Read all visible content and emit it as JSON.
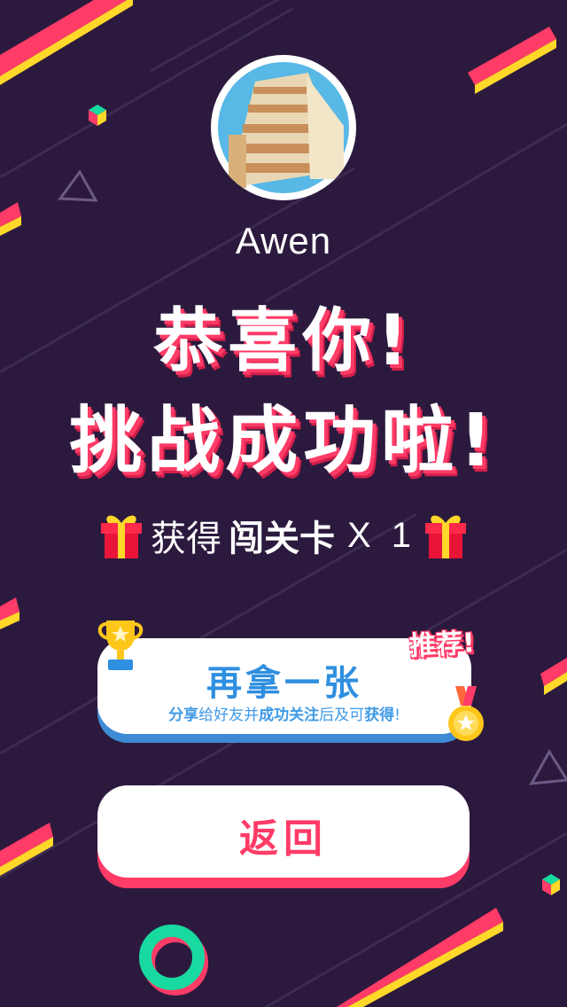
{
  "user": {
    "name": "Awen"
  },
  "headline": {
    "line1": "恭喜你!",
    "line2": "挑战成功啦!"
  },
  "reward": {
    "prefix": "获得",
    "item": "闯关卡",
    "count": "X 1",
    "icon": "gift-icon"
  },
  "again_card": {
    "title": "再拿一张",
    "subtitle_parts": [
      "分享",
      "给好友并",
      "成功关注",
      "后及可",
      "获得",
      "!"
    ],
    "badge": "推荐!",
    "icons": [
      "trophy-icon",
      "medal-icon"
    ]
  },
  "back_button": {
    "label": "返回"
  },
  "colors": {
    "background": "#2c1a3e",
    "accent_red": "#ff3b67",
    "accent_blue": "#2f8fe0",
    "stripe_yellow": "#ffd82a",
    "ring_green": "#18d9a0"
  }
}
